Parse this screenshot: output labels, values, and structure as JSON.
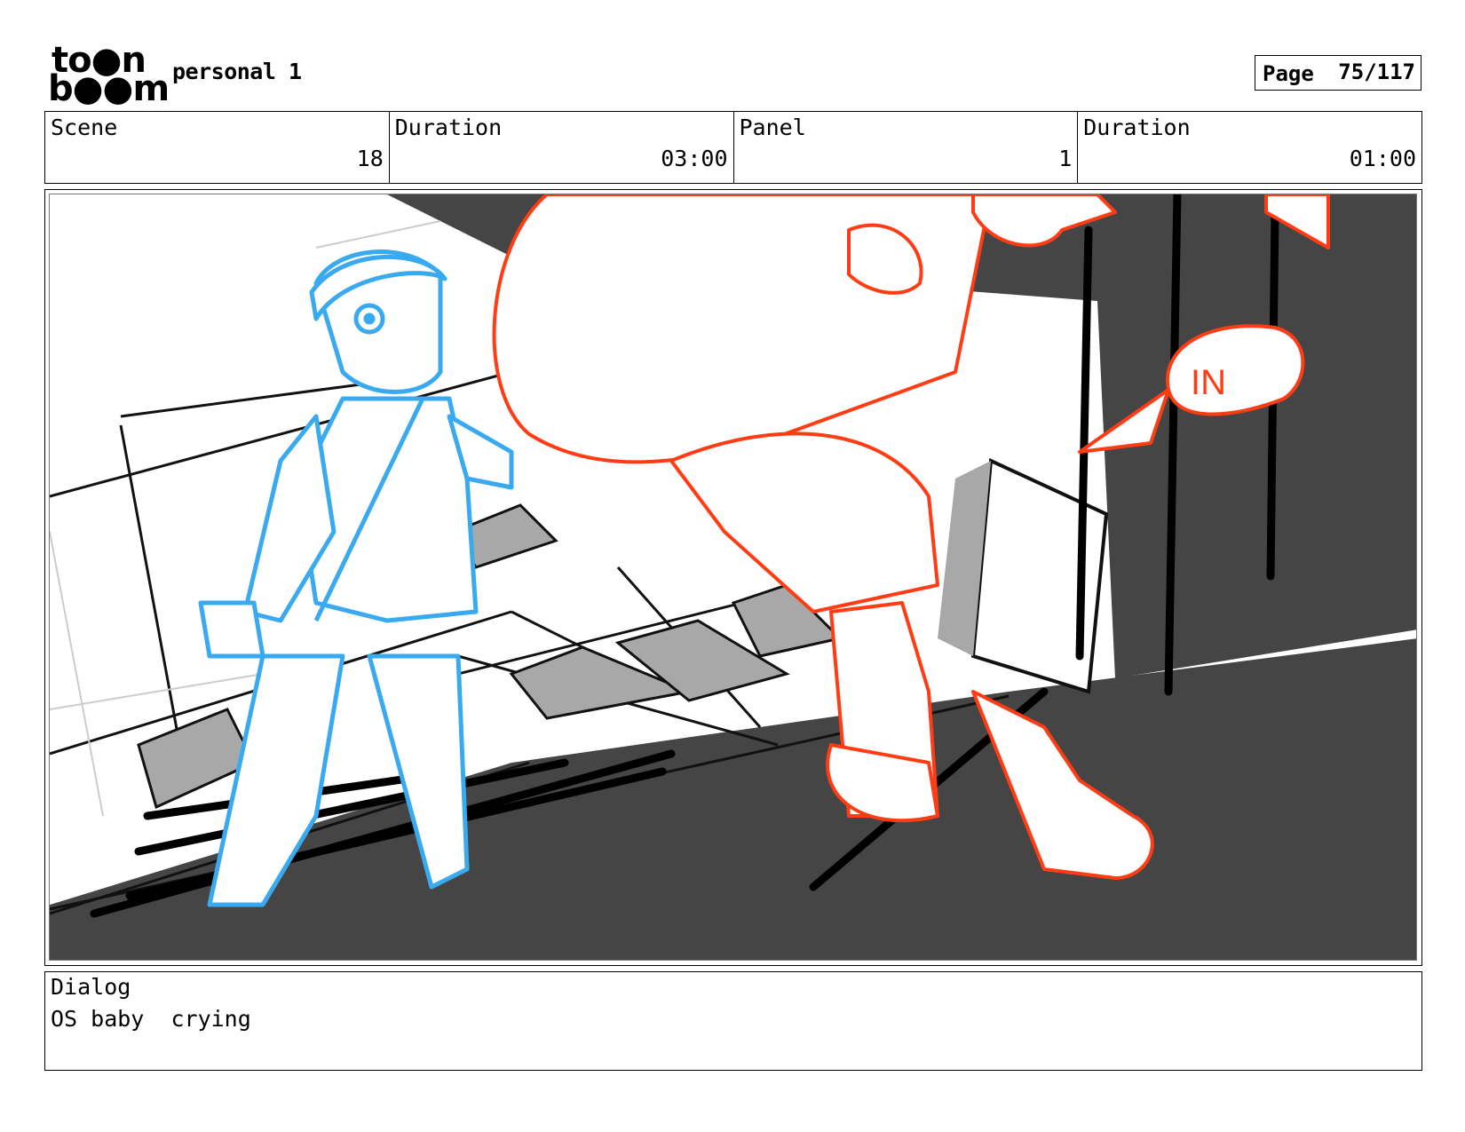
{
  "header": {
    "logo_line1": "to●n",
    "logo_line2": "b●●m",
    "project_title": "personal 1",
    "page_label": "Page",
    "page_value": "75/117"
  },
  "info": {
    "scene_label": "Scene",
    "scene_value": "18",
    "scene_duration_label": "Duration",
    "scene_duration_value": "03:00",
    "panel_label": "Panel",
    "panel_value": "1",
    "panel_duration_label": "Duration",
    "panel_duration_value": "01:00"
  },
  "panel": {
    "annotation": "IN",
    "colors": {
      "character_blue": "#3aaaf0",
      "character_red": "#ff3c14",
      "dark_gray": "#454545",
      "mid_gray": "#a8a8a8"
    }
  },
  "dialog": {
    "label": "Dialog",
    "text": "OS baby  crying"
  }
}
